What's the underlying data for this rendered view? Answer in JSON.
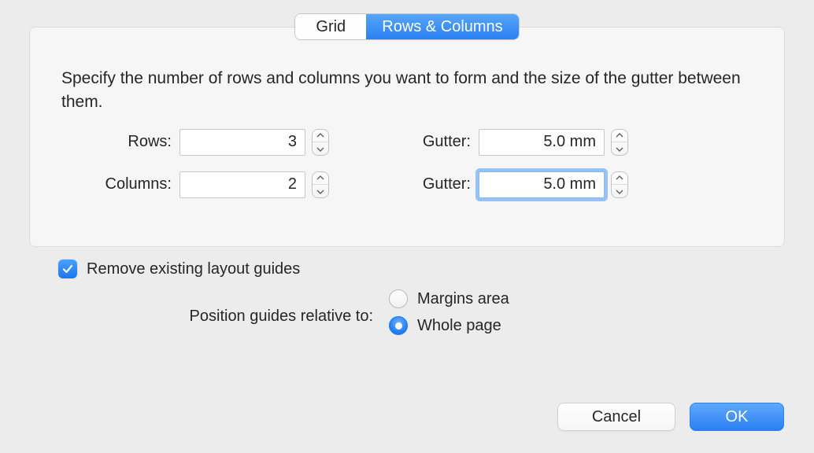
{
  "tabs": {
    "grid": "Grid",
    "rows_columns": "Rows & Columns"
  },
  "panel": {
    "description": "Specify the number of rows and columns you want to form and the size of the gutter between them.",
    "rows_label": "Rows:",
    "rows_value": "3",
    "columns_label": "Columns:",
    "columns_value": "2",
    "gutter_label": "Gutter:",
    "row_gutter_value": "5.0 mm",
    "column_gutter_value": "5.0 mm"
  },
  "options": {
    "remove_guides_label": "Remove existing layout guides",
    "remove_guides_checked": true,
    "relative_label": "Position guides relative to:",
    "radio_margins": "Margins area",
    "radio_whole": "Whole page",
    "radio_selected": "whole"
  },
  "buttons": {
    "cancel": "Cancel",
    "ok": "OK"
  }
}
